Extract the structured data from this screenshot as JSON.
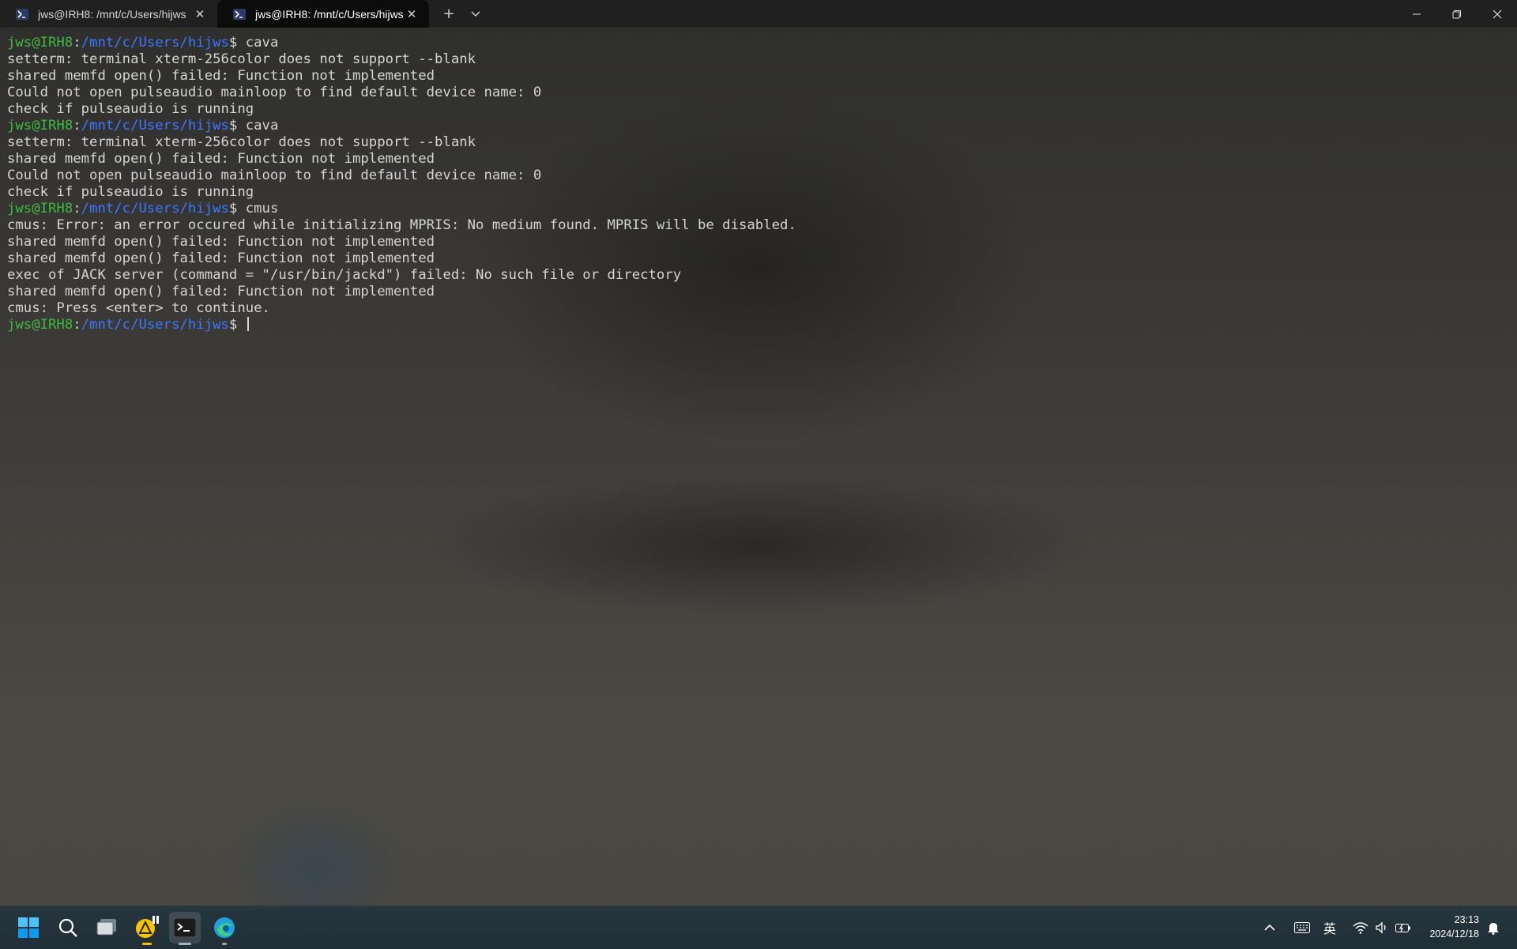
{
  "tabs": [
    {
      "title": "jws@IRH8: /mnt/c/Users/hijws",
      "active": false
    },
    {
      "title": "jws@IRH8: /mnt/c/Users/hijws",
      "active": true
    }
  ],
  "tab_actions": {
    "new_tab": "+",
    "dropdown": "⌄"
  },
  "prompt": {
    "user": "jws@IRH8",
    "path": "/mnt/c/Users/hijws",
    "symbol": "$"
  },
  "terminal_lines": [
    {
      "type": "prompt",
      "cmd": " cava"
    },
    {
      "type": "output",
      "text": "setterm: terminal xterm-256color does not support --blank"
    },
    {
      "type": "output",
      "text": "shared memfd open() failed: Function not implemented"
    },
    {
      "type": "output",
      "text": "Could not open pulseaudio mainloop to find default device name: 0"
    },
    {
      "type": "output",
      "text": "check if pulseaudio is running"
    },
    {
      "type": "prompt",
      "cmd": " cava"
    },
    {
      "type": "output",
      "text": "setterm: terminal xterm-256color does not support --blank"
    },
    {
      "type": "output",
      "text": "shared memfd open() failed: Function not implemented"
    },
    {
      "type": "output",
      "text": "Could not open pulseaudio mainloop to find default device name: 0"
    },
    {
      "type": "output",
      "text": "check if pulseaudio is running"
    },
    {
      "type": "prompt",
      "cmd": " cmus"
    },
    {
      "type": "output",
      "text": "cmus: Error: an error occured while initializing MPRIS: No medium found. MPRIS will be disabled."
    },
    {
      "type": "output",
      "text": "shared memfd open() failed: Function not implemented"
    },
    {
      "type": "output",
      "text": "shared memfd open() failed: Function not implemented"
    },
    {
      "type": "output",
      "text": "exec of JACK server (command = \"/usr/bin/jackd\") failed: No such file or directory"
    },
    {
      "type": "output",
      "text": "shared memfd open() failed: Function not implemented"
    },
    {
      "type": "output",
      "text": "cmus: Press <enter> to continue."
    },
    {
      "type": "prompt",
      "cmd": " ",
      "cursor": true
    }
  ],
  "taskbar": {
    "apps": [
      {
        "name": "start",
        "icon": "windows-logo-icon"
      },
      {
        "name": "search",
        "icon": "search-icon"
      },
      {
        "name": "task-view",
        "icon": "task-view-icon"
      },
      {
        "name": "app",
        "icon": "yellow-app-icon"
      },
      {
        "name": "terminal",
        "icon": "terminal-icon",
        "active": true
      },
      {
        "name": "edge",
        "icon": "edge-browser-icon"
      }
    ],
    "tray": {
      "overflow": "^",
      "ime": "英",
      "time": "23:13",
      "date": "2024/12/18"
    }
  },
  "colors": {
    "prompt_user": "#3fb93f",
    "prompt_path": "#3b78ff",
    "text": "#d4d4d4",
    "accent": "#0078d4"
  }
}
